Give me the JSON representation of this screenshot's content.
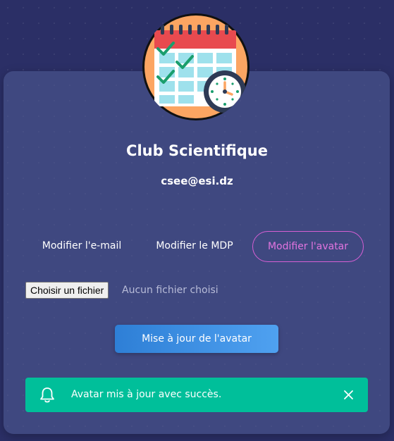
{
  "profile": {
    "name": "Club Scientifique",
    "email": "csee@esi.dz",
    "avatar_icon": "calendar-clock-icon"
  },
  "tabs": [
    {
      "label": "Modifier l'e-mail",
      "active": false
    },
    {
      "label": "Modifier le MDP",
      "active": false
    },
    {
      "label": "Modifier l'avatar",
      "active": true
    }
  ],
  "file_input": {
    "button_label": "Choisir un fichier",
    "status": "Aucun fichier choisi"
  },
  "submit_label": "Mise à jour de l'avatar",
  "alert": {
    "message": "Avatar mis à jour avec succès.",
    "icon": "bell-icon",
    "close_icon": "close-icon"
  },
  "colors": {
    "background": "#2b2f66",
    "active_tab": "#e274df",
    "button": "#3a8de3",
    "alert": "#00bf9a"
  }
}
